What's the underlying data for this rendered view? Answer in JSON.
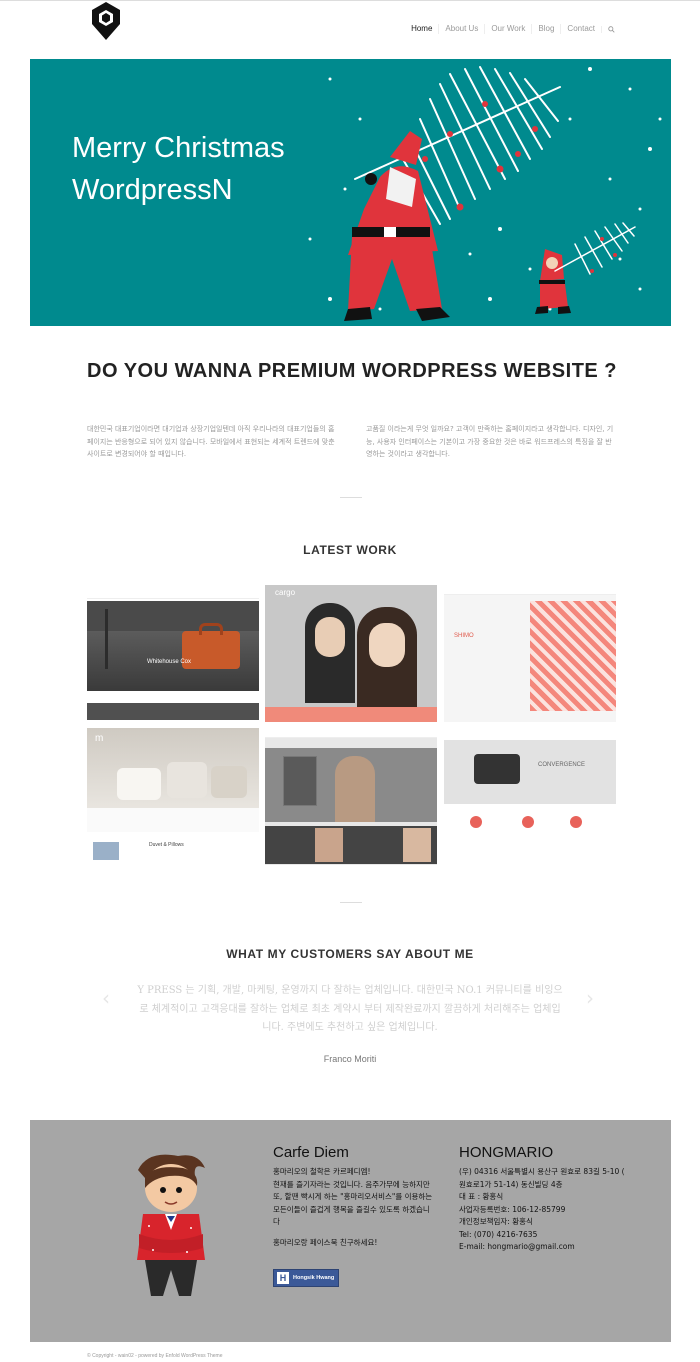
{
  "nav": {
    "items": [
      "Home",
      "About Us",
      "Our Work",
      "Blog",
      "Contact"
    ],
    "search_icon": "search-icon"
  },
  "hero": {
    "line1": "Merry Christmas",
    "line2": "WordpressN",
    "bg_color": "#008a8e"
  },
  "intro": {
    "heading": "DO YOU WANNA PREMIUM WORDPRESS WEBSITE ?",
    "left": "대한민국 대표기업이라면 대기업과 상장기업일텐데 아직 우리나라의 대표기업들의 홈페이지는 반응형으로 되어 있지 않습니다. 모바일에서 표현되는 세계적 트렌드에 맞춘 사이트로 변경되어야 할 때입니다.",
    "right": "고품질 이라는게 무엇 일까요? 고객이 만족하는 홈페이지라고 생각합니다. 디자인, 기능, 사용자 인터페이스는 기본이고 가장 중요한 것은 바로 워드프레스의 특징을 잘 반영하는 것이라고 생각합니다."
  },
  "latest_work": {
    "heading": "LATEST WORK",
    "tiles": [
      {
        "name": "whitehouse-cox",
        "caption": "Whitehouse Cox"
      },
      {
        "name": "cargo",
        "caption": "cargo"
      },
      {
        "name": "pattern-site",
        "caption": ""
      },
      {
        "name": "linen-site",
        "caption": "Duvet & Pillows"
      },
      {
        "name": "fashion-site",
        "caption": ""
      },
      {
        "name": "convergence-site",
        "caption": "CONVERGENCE"
      }
    ]
  },
  "testimonial": {
    "heading": "WHAT MY CUSTOMERS SAY ABOUT ME",
    "quote": "Y PRESS 는 기획, 개발, 마케팅, 운영까지 다 잘하는 업체입니다. 대한민국 NO.1 커뮤니티를 비잉으로 체계적이고 고객응대를 잘하는 업체로 최초 계약시 부터 제작완료까지 깔끔하게 처리해주는 업체입니다. 주변에도 추천하고 싶은 업체입니다.",
    "author": "Franco Moriti"
  },
  "footer": {
    "col1_title": "Carfe Diem",
    "col1_text": "홍마리오의 철학은 카르페디엠!\n현재를 즐기자라는 것입니다. 음주가무에 능하지만 또, 할땐 빡시게 하는 \"홍마리오서비스\"를 이용하는 모든이들이 즐겁게 행복을 즐길수 있도록 하겠습니다",
    "col1_fb_text": "홍마리오랑 페이스북 친구하세요!",
    "fb_button": "Hongsik Hwang",
    "col2_title": "HONGMARIO",
    "col2_lines": [
      "(우) 04316 서울특별시 용산구 원효로 83길 5-10 ( 원효로1가 51-14) 동신빌딩 4층",
      "대 표 : 황홍식",
      "사업자등록번호: 106-12-85799",
      "개인정보책임자: 황홍식",
      "Tel: (070) 4216-7635",
      "E-mail: hongmario@gmail.com"
    ]
  },
  "copyright": "© Copyright - wain02 - powered by Enfold WordPress Theme"
}
